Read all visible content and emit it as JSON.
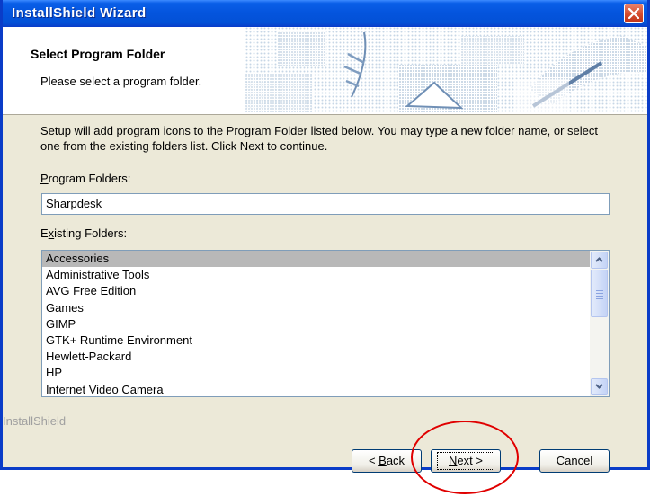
{
  "window": {
    "title": "InstallShield Wizard"
  },
  "header": {
    "title": "Select Program Folder",
    "subtitle": "Please select a program folder."
  },
  "body": {
    "description": "Setup will add program icons to the Program Folder listed below.  You may type a new folder name, or select one from the existing folders list.  Click Next to continue.",
    "program_folders_label": {
      "accel": "P",
      "rest": "rogram Folders:"
    },
    "program_folder_value": "Sharpdesk",
    "existing_folders_label": {
      "pre": "E",
      "accel": "x",
      "rest": "isting Folders:"
    },
    "existing_folders": [
      "Accessories",
      "Administrative Tools",
      "AVG Free Edition",
      "Games",
      "GIMP",
      "GTK+ Runtime Environment",
      "Hewlett-Packard",
      "HP",
      "Internet Video Camera"
    ],
    "selected_folder": "Accessories"
  },
  "footer": {
    "brand": "InstallShield",
    "back": {
      "pre": "< ",
      "accel": "B",
      "rest": "ack"
    },
    "next": {
      "accel": "N",
      "rest": "ext >"
    },
    "cancel": "Cancel"
  },
  "annotation_color": "#e00000"
}
